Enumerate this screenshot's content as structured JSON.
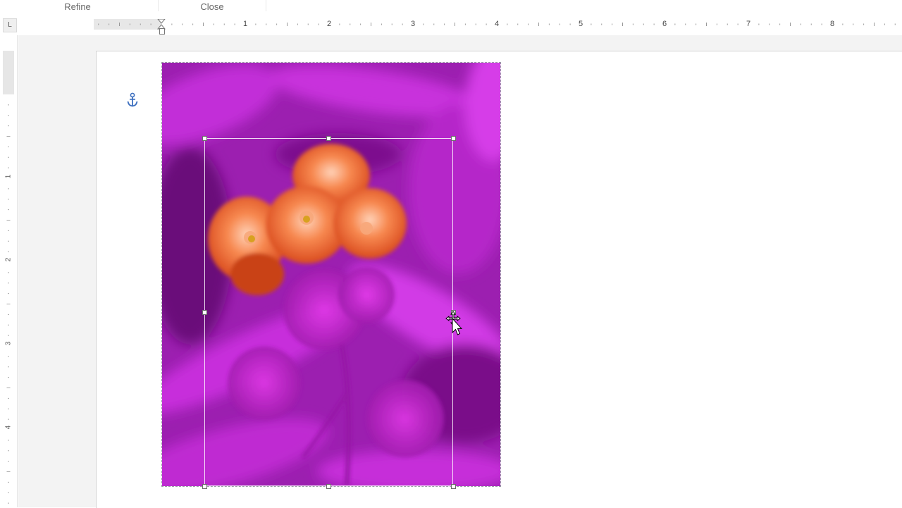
{
  "ribbon": {
    "groups": [
      {
        "label": "Refine"
      },
      {
        "label": "Close"
      }
    ]
  },
  "ruler": {
    "tab_selector": "L",
    "horizontal_numbers": [
      "1",
      "2",
      "3",
      "4",
      "5",
      "6",
      "7",
      "8"
    ],
    "vertical_numbers": [
      "1",
      "2",
      "3",
      "4"
    ]
  },
  "picture": {
    "description_icon": "photo-roses",
    "fill_tint": "#b21fc6",
    "flower_color": "#f06a3a"
  },
  "colors": {
    "ruler_margin": "#e7e7e7",
    "anchor": "#3d6fbf",
    "canvas": "#f3f3f3"
  }
}
